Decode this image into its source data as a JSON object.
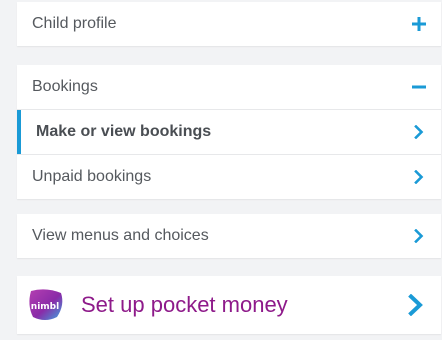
{
  "child_profile": {
    "label": "Child profile",
    "icon": "plus-icon"
  },
  "bookings": {
    "label": "Bookings",
    "icon": "minus-icon",
    "items": [
      {
        "label": "Make or view bookings",
        "active": true,
        "icon": "chevron-right-icon"
      },
      {
        "label": "Unpaid bookings",
        "active": false,
        "icon": "chevron-right-icon"
      }
    ]
  },
  "menus": {
    "label": "View menus and choices",
    "icon": "chevron-right-icon"
  },
  "pocket_money": {
    "logo_text": "nimbl",
    "label": "Set up pocket money",
    "icon": "chevron-right-icon"
  },
  "colors": {
    "accent_blue": "#1a9ad6",
    "brand_purple": "#8e1a8a",
    "text_gray": "#55595e",
    "background": "#f2f3f5"
  }
}
